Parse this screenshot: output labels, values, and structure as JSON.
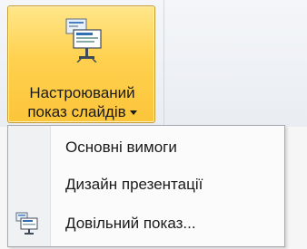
{
  "button": {
    "label_line1": "Настроюваний",
    "label_line2": "показ слайдів",
    "icon": "custom-slide-show-icon",
    "state": "pressed",
    "accent": "#ffd14f"
  },
  "menu": {
    "items": [
      {
        "label": "Основні вимоги",
        "icon": null
      },
      {
        "label": "Дизайн презентації",
        "icon": null
      },
      {
        "label": "Довільний показ...",
        "icon": "custom-show-icon"
      }
    ]
  }
}
